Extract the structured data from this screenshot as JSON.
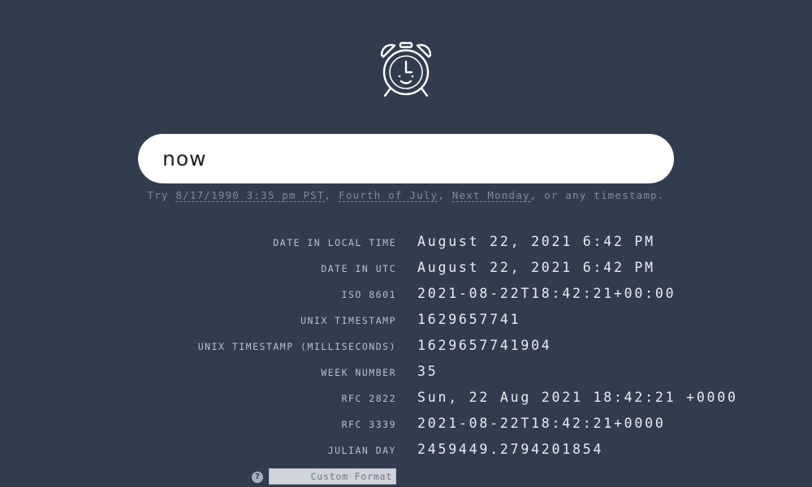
{
  "search": {
    "value": "now"
  },
  "hint": {
    "prefix": "Try ",
    "examples": [
      "8/17/1990 3:35 pm PST",
      "Fourth of July",
      "Next Monday"
    ],
    "sep1": ", ",
    "sep2": ", ",
    "suffix": ", or any timestamp."
  },
  "results": [
    {
      "label": "Date in local time",
      "value": "August 22, 2021 6:42 PM"
    },
    {
      "label": "Date in UTC",
      "value": "August 22, 2021 6:42 PM"
    },
    {
      "label": "ISO 8601",
      "value": "2021-08-22T18:42:21+00:00"
    },
    {
      "label": "Unix Timestamp",
      "value": "1629657741"
    },
    {
      "label": "Unix Timestamp (milliseconds)",
      "value": "1629657741904"
    },
    {
      "label": "Week Number",
      "value": "35"
    },
    {
      "label": "RFC 2822",
      "value": "Sun, 22 Aug 2021 18:42:21 +0000"
    },
    {
      "label": "RFC 3339",
      "value": "2021-08-22T18:42:21+0000"
    },
    {
      "label": "Julian Day",
      "value": "2459449.2794201854"
    }
  ],
  "custom_format": {
    "placeholder": "Custom Format",
    "help_icon": "?"
  },
  "icons": {
    "logo": "smiling-alarm-clock-icon",
    "help": "question-mark-icon"
  },
  "colors": {
    "background": "#313d4e",
    "text": "#e9ecf1",
    "muted": "#7f8a9a"
  }
}
